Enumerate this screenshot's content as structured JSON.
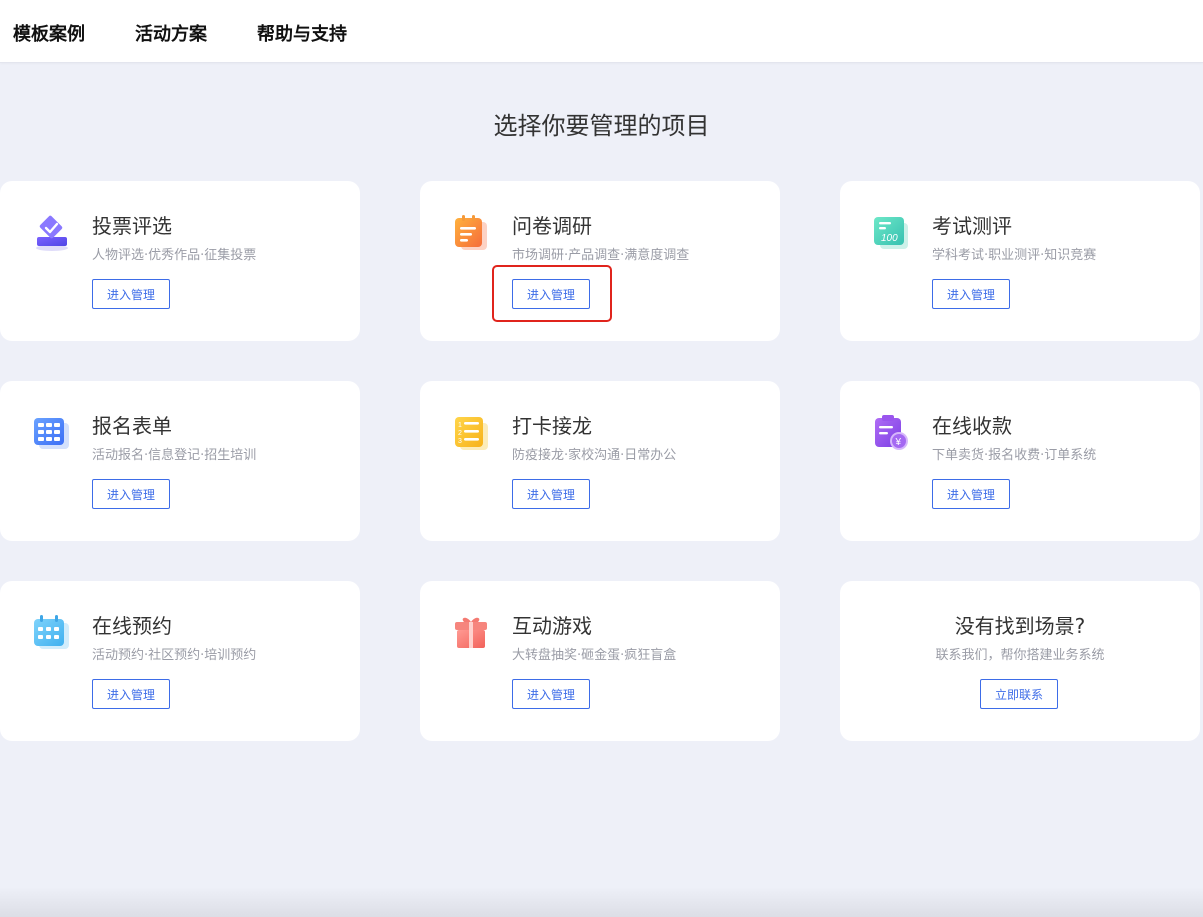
{
  "nav": {
    "items": [
      {
        "label": "模板案例"
      },
      {
        "label": "活动方案"
      },
      {
        "label": "帮助与支持"
      }
    ]
  },
  "page": {
    "title": "选择你要管理的项目"
  },
  "cards": [
    {
      "title": "投票评选",
      "desc": "人物评选·优秀作品·征集投票",
      "button": "进入管理",
      "icon": "vote-icon"
    },
    {
      "title": "问卷调研",
      "desc": "市场调研·产品调查·满意度调查",
      "button": "进入管理",
      "icon": "questionnaire-icon"
    },
    {
      "title": "考试测评",
      "desc": "学科考试·职业测评·知识竞赛",
      "button": "进入管理",
      "icon": "exam-icon"
    },
    {
      "title": "报名表单",
      "desc": "活动报名·信息登记·招生培训",
      "button": "进入管理",
      "icon": "form-grid-icon"
    },
    {
      "title": "打卡接龙",
      "desc": "防疫接龙·家校沟通·日常办公",
      "button": "进入管理",
      "icon": "checklist-icon"
    },
    {
      "title": "在线收款",
      "desc": "下单卖货·报名收费·订单系统",
      "button": "进入管理",
      "icon": "payment-icon"
    },
    {
      "title": "在线预约",
      "desc": "活动预约·社区预约·培训预约",
      "button": "进入管理",
      "icon": "calendar-icon"
    },
    {
      "title": "互动游戏",
      "desc": "大转盘抽奖·砸金蛋·疯狂盲盒",
      "button": "进入管理",
      "icon": "gift-icon"
    }
  ],
  "contact_card": {
    "title": "没有找到场景?",
    "desc": "联系我们，帮你搭建业务系统",
    "button": "立即联系"
  },
  "colors": {
    "accent": "#3d6ce8",
    "highlight": "#e0241c",
    "background": "#eef0f8"
  }
}
